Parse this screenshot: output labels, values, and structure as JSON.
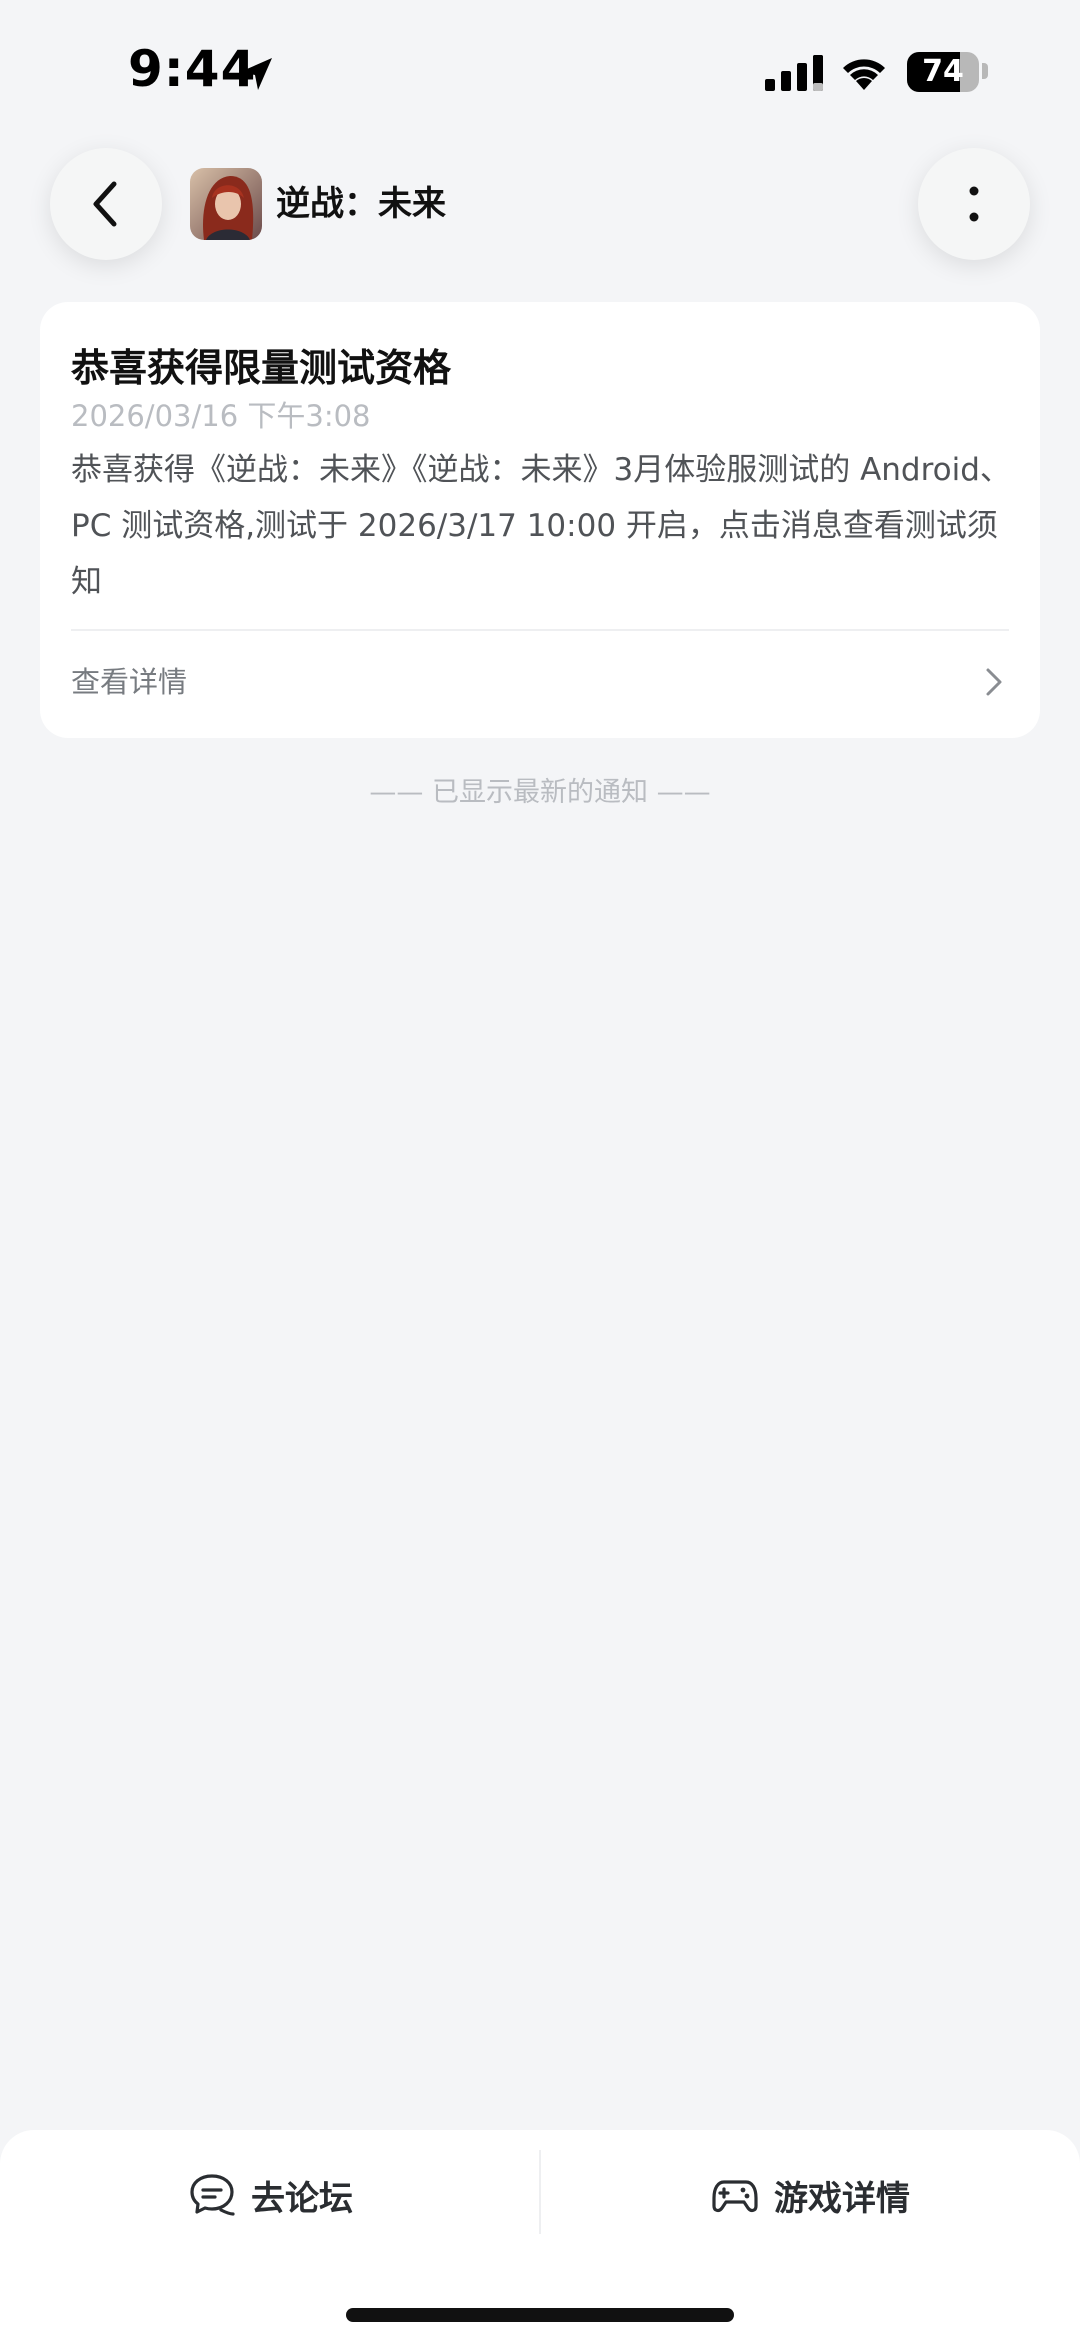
{
  "status_bar": {
    "time": "9:44",
    "battery_level": "74",
    "battery_fraction": 0.74
  },
  "header": {
    "title": "逆战：未来",
    "back_icon": "chevron-left-icon",
    "more_icon": "more-vertical-icon"
  },
  "notification": {
    "title": "恭喜获得限量测试资格",
    "time": "2026/03/16 下午3:08",
    "body": "恭喜获得《逆战：未来》《逆战：未来》3月体验服测试的 Android、PC 测试资格,测试于 2026/3/17 10:00 开启，点击消息查看测试须知",
    "detail_label": "查看详情"
  },
  "end_note": "—— 已显示最新的通知 ——",
  "bottom_bar": {
    "forum_label": "去论坛",
    "forum_icon": "chat-bubble-icon",
    "game_detail_label": "游戏详情",
    "game_detail_icon": "gamepad-icon"
  }
}
